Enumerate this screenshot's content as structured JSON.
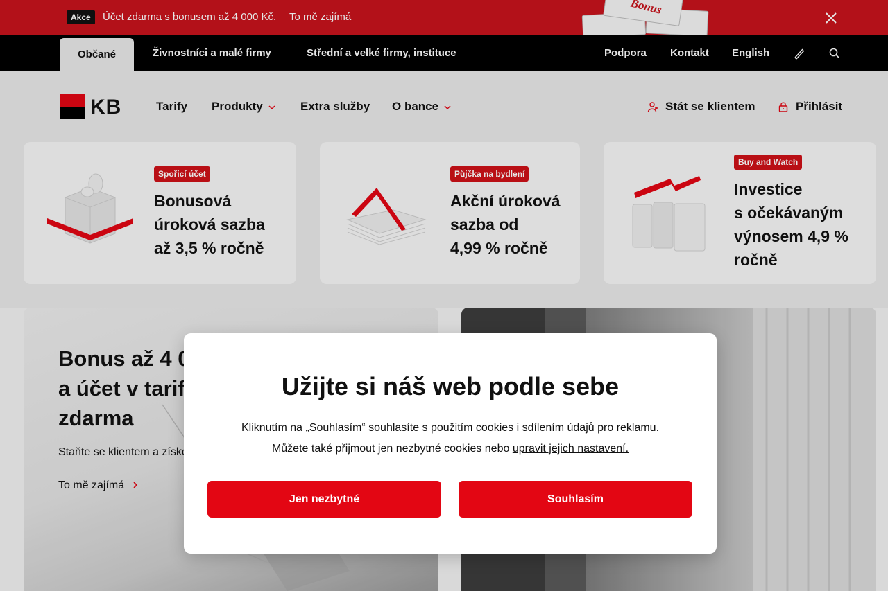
{
  "promo": {
    "badge": "Akce",
    "text": "Účet zdarma s bonusem až 4 000 Kč.",
    "link": "To mě zajímá",
    "art_text": "Bonus"
  },
  "segments": [
    {
      "label": "Občané",
      "active": true
    },
    {
      "label": "Živnostníci a malé firmy",
      "active": false
    },
    {
      "label": "Střední a velké firmy, instituce",
      "active": false
    }
  ],
  "utility": {
    "support": "Podpora",
    "contact": "Kontakt",
    "language": "English"
  },
  "logo_text": "KB",
  "nav": {
    "tarify": "Tarify",
    "produkty": "Produkty",
    "extra": "Extra služby",
    "obance": "O bance",
    "become_client": "Stát se klientem",
    "login": "Přihlásit"
  },
  "cards": [
    {
      "tag": "Spořicí účet",
      "lines": [
        "Bonusová",
        "úroková sazba",
        "až 3,5 % ročně"
      ]
    },
    {
      "tag": "Půjčka na bydlení",
      "lines": [
        "Akční úroková",
        "sazba od",
        "4,99 % ročně"
      ]
    },
    {
      "tag": "Buy and Watch",
      "lines": [
        "Investice",
        "s očekávaným",
        "výnosem 4,9 %",
        "ročně"
      ]
    }
  ],
  "hero": {
    "title_lines": [
      "Bonus až 4 000 Kč",
      "a účet v tarifu",
      "zdarma"
    ],
    "subtitle": "Staňte se klientem a získejte bonus",
    "link": "To mě zajímá"
  },
  "modal": {
    "title": "Užijte si náš web podle sebe",
    "line1": "Kliknutím na „Souhlasím“ souhlasíte s použitím cookies i sdílením údajů pro reklamu.",
    "line2_prefix": "Můžete také přijmout jen nezbytné cookies nebo ",
    "line2_link": "upravit jejich nastavení.",
    "btn_necessary": "Jen nezbytné",
    "btn_agree": "Souhlasím"
  },
  "colors": {
    "brand_red": "#e30613",
    "promo_red": "#c8141c",
    "black": "#000000"
  }
}
